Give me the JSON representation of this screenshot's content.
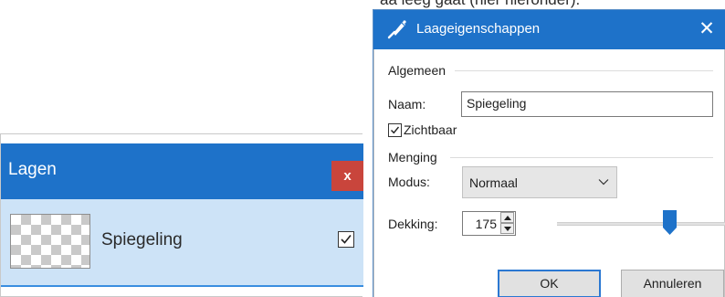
{
  "top_fragment": "aa leeg gaat (hier hieronder).",
  "layers_panel": {
    "title": "Lagen",
    "close_label": "x",
    "layer": {
      "name": "Spiegeling",
      "visible": true
    }
  },
  "dialog": {
    "title": "Laageigenschappen",
    "close_label": "✕",
    "general": {
      "heading": "Algemeen",
      "name_label": "Naam:",
      "name_value": "Spiegeling",
      "visible_label": "Zichtbaar",
      "visible_checked": true
    },
    "blending": {
      "heading": "Menging",
      "mode_label": "Modus:",
      "mode_value": "Normaal",
      "opacity_label": "Dekking:",
      "opacity_value": "175",
      "opacity_fraction": 0.686
    },
    "buttons": {
      "ok_label": "OK",
      "cancel_label": "Annuleren"
    }
  },
  "colors": {
    "titlebar": "#1e72c9",
    "close_red": "#c9453c",
    "selected_row": "#cde3f7",
    "slider_thumb": "#1e72c9"
  }
}
